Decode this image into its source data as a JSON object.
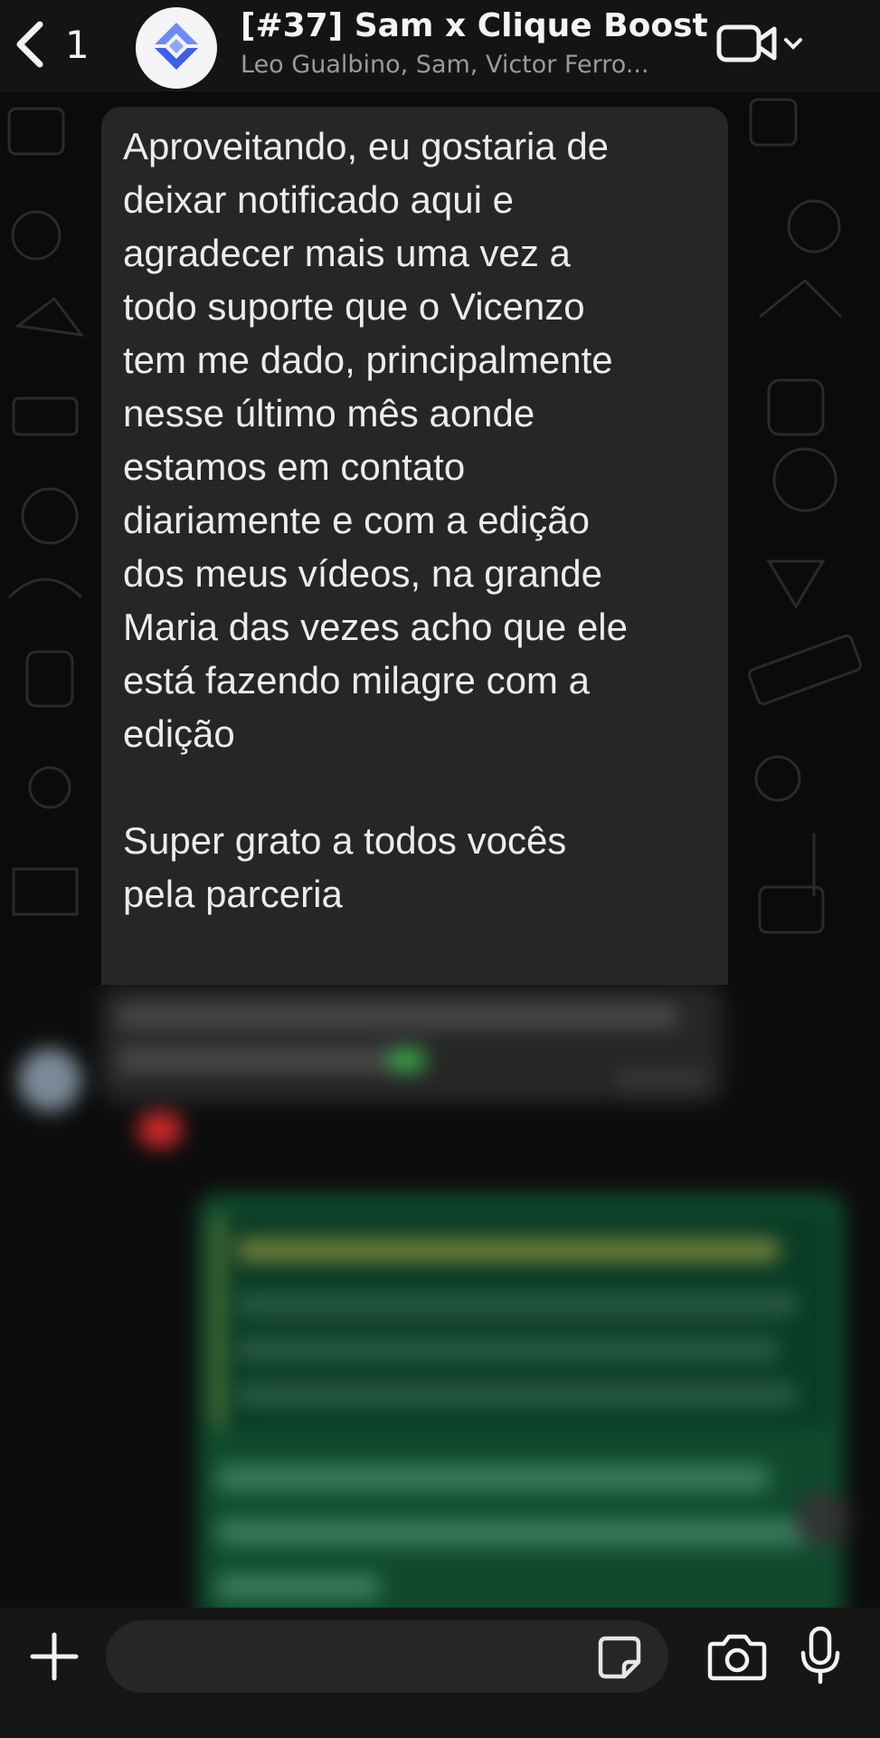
{
  "header": {
    "back_count": "1",
    "title": "[#37] Sam x Clique Boost",
    "members": "Leo Gualbino, Sam, Victor Ferro..."
  },
  "message": {
    "text": "Aproveitando, eu gostaria de\ndeixar notificado aqui e\nagradecer mais uma vez a\ntodo suporte que o Vicenzo\ntem me dado, principalmente\nnesse último mês aonde\nestamos em contato\ndiariamente e com a edição\ndos meus vídeos, na grande\nMaria das vezes acho que ele\nestá fazendo milagre com a\nedição\n\nSuper grato a todos vocês\npela parceria"
  },
  "icons": {
    "back": "chevron-left-icon",
    "group_avatar": "clique-boost-logo",
    "video": "video-camera-icon",
    "dropdown": "chevron-down-icon",
    "plus": "plus-icon",
    "sticker": "sticker-icon",
    "camera": "camera-icon",
    "mic": "microphone-icon"
  },
  "colors": {
    "background": "#0b0b0b",
    "header": "#141414",
    "incoming_bubble": "#262626",
    "outgoing_bubble": "#0f4a2e",
    "logo_blue": "#4a6cf2"
  }
}
